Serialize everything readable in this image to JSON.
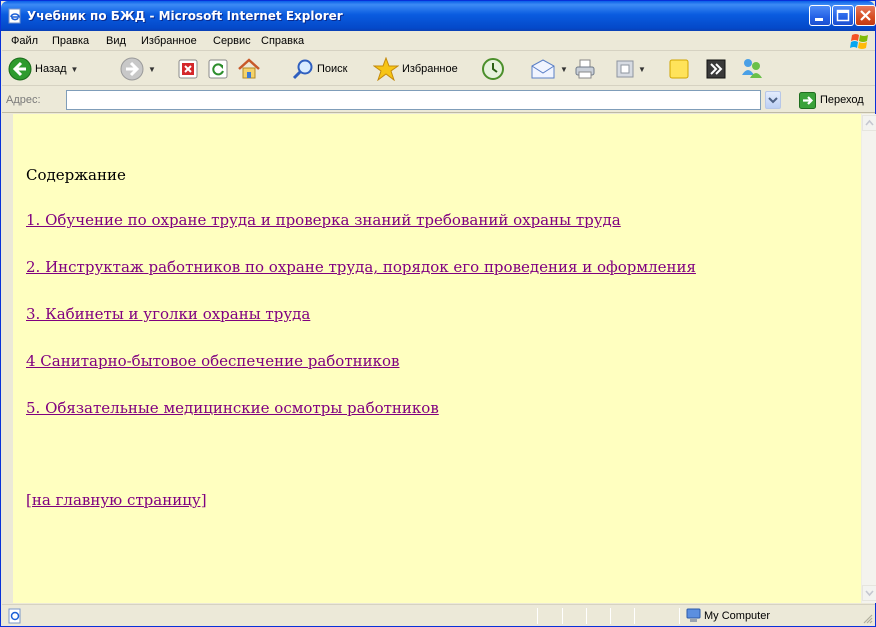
{
  "window": {
    "title": "Учебник по БЖД - Microsoft Internet Explorer"
  },
  "menu": {
    "items": [
      "Файл",
      "Правка",
      "Вид",
      "Избранное",
      "Сервис",
      "Справка"
    ]
  },
  "toolbar": {
    "back_label": "Назад",
    "search_label": "Поиск",
    "favorites_label": "Избранное"
  },
  "address": {
    "label": "Адрес:",
    "value": "",
    "go_label": "Переход"
  },
  "content": {
    "heading": "Содержание",
    "links": [
      "1. Обучение по охране труда и проверка знаний требований охраны труда",
      "2. Инструктаж работников по охране труда, порядок его проведения и оформления",
      "3. Кабинеты и уголки охраны труда",
      "4 Санитарно-бытовое обеспечение работников",
      "5. Обязательные медицинские осмотры работников"
    ],
    "home_link": "[на главную страницу]",
    "link_color": "#800080",
    "background_color": "#ffffc0"
  },
  "status": {
    "zone": "My Computer"
  },
  "colors": {
    "titlebar": "#0a5ce0",
    "chrome": "#ece9d8"
  }
}
